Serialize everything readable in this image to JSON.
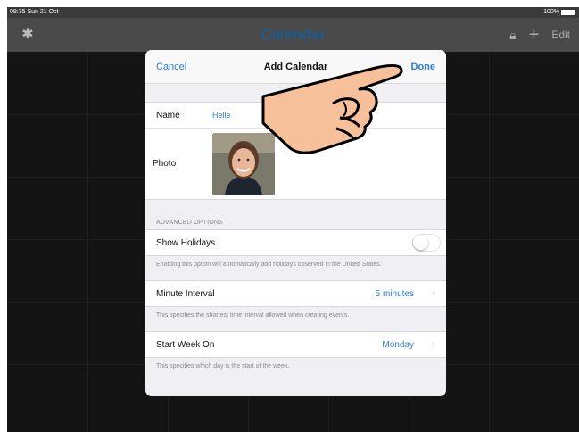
{
  "status": {
    "time": "09:35",
    "date": "Sun 21 Oct",
    "battery": "100%"
  },
  "navbar": {
    "title": "Calendar",
    "edit_label": "Edit",
    "settings_icon": "gear-icon",
    "lock_icon": "lock-icon",
    "add_icon": "plus-icon"
  },
  "modal": {
    "title": "Add Calendar",
    "cancel_label": "Cancel",
    "done_label": "Done",
    "name_label": "Name",
    "name_value": "Helle",
    "photo_label": "Photo",
    "advanced_header": "ADVANCED OPTIONS",
    "holidays_label": "Show Holidays",
    "holidays_enabled": false,
    "holidays_note": "Enabling this option will automatically add holidays observed in the United States.",
    "interval_label": "Minute Interval",
    "interval_value": "5 minutes",
    "interval_note": "This specifies the shortest time interval allowed when creating events.",
    "week_label": "Start Week On",
    "week_value": "Monday",
    "week_note": "This specifies which day is the start of the week."
  },
  "colors": {
    "accent": "#2e7dd1",
    "title": "#1f5b91",
    "hand": "#f6c19a"
  }
}
